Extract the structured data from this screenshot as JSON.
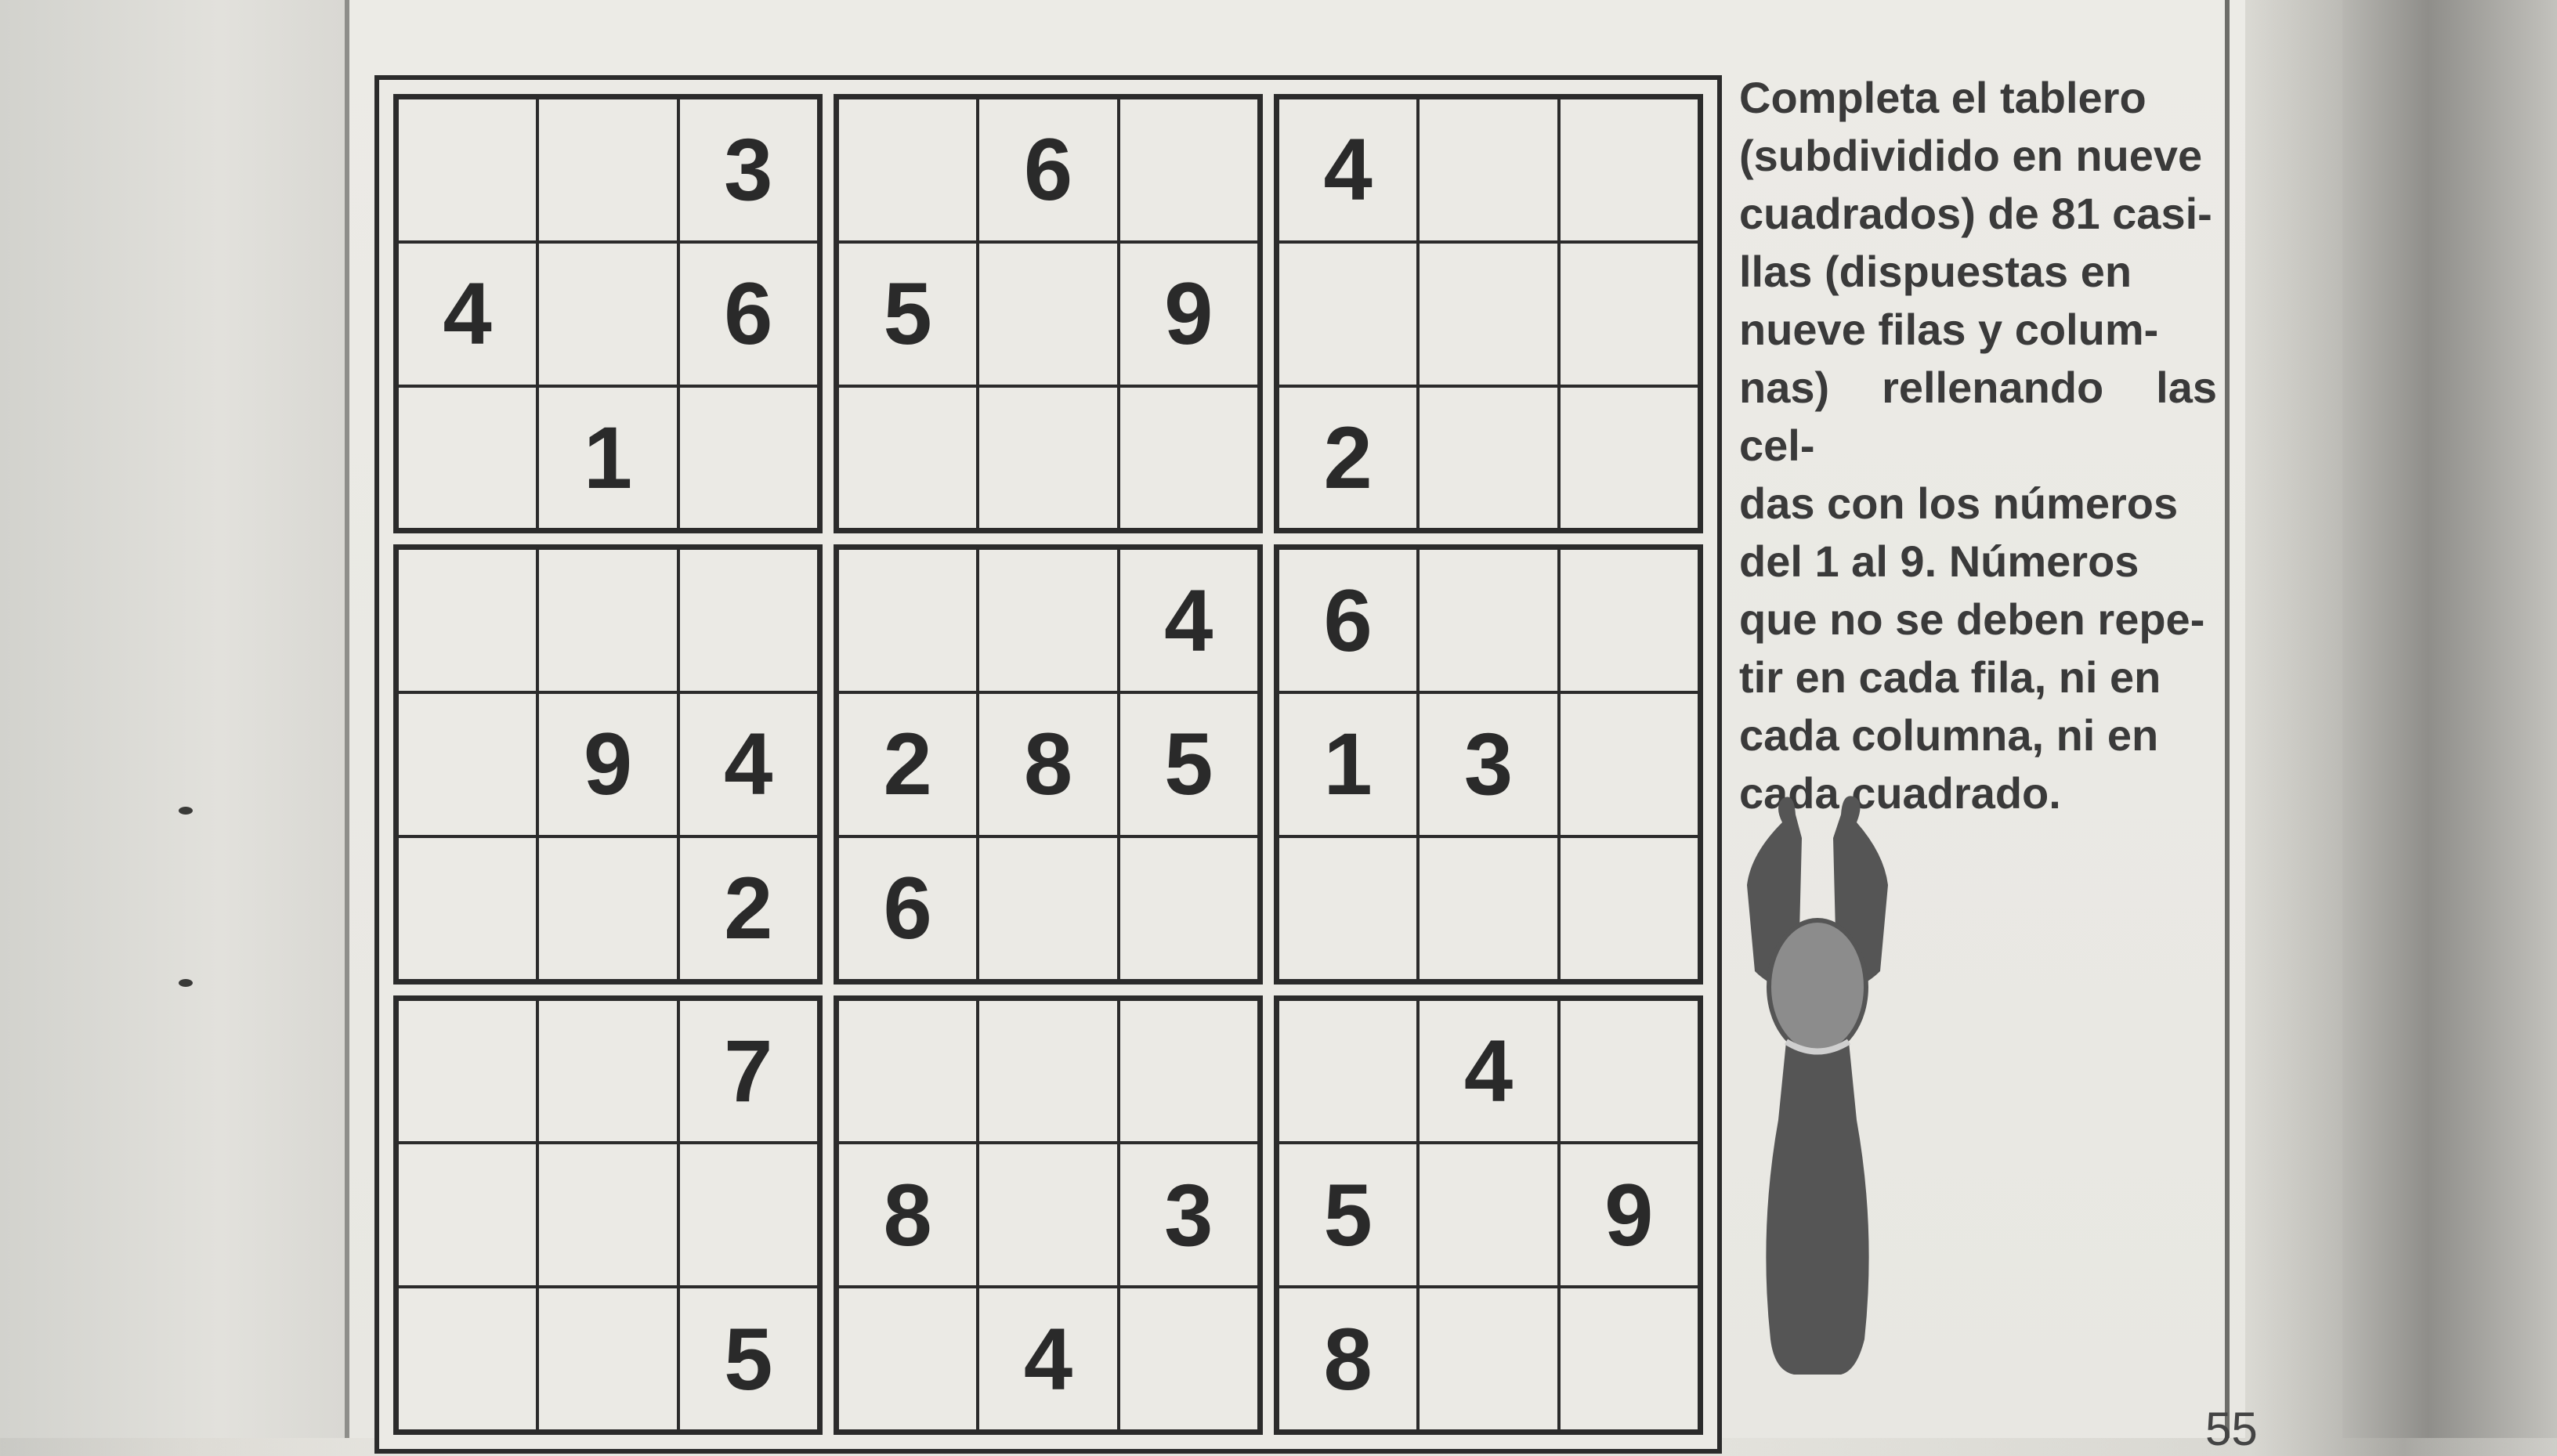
{
  "puzzle": {
    "grid": [
      [
        "",
        "",
        "3",
        "",
        "6",
        "",
        "4",
        "",
        ""
      ],
      [
        "4",
        "",
        "6",
        "5",
        "",
        "9",
        "",
        "",
        ""
      ],
      [
        "",
        "1",
        "",
        "",
        "",
        "",
        "2",
        "",
        ""
      ],
      [
        "",
        "",
        "",
        "",
        "",
        "4",
        "6",
        "",
        ""
      ],
      [
        "",
        "9",
        "4",
        "2",
        "8",
        "5",
        "1",
        "3",
        ""
      ],
      [
        "",
        "",
        "2",
        "6",
        "",
        "",
        "",
        "",
        ""
      ],
      [
        "",
        "",
        "7",
        "",
        "",
        "",
        "",
        "4",
        ""
      ],
      [
        "",
        "",
        "",
        "8",
        "",
        "3",
        "5",
        "",
        "9"
      ],
      [
        "",
        "",
        "5",
        "",
        "4",
        "",
        "8",
        "",
        ""
      ]
    ]
  },
  "instructions": {
    "lines": [
      "Completa el tablero",
      "(subdividido en nueve",
      "cuadrados) de 81 casi-",
      "llas (dispuestas en",
      "nueve filas y colum-",
      "nas) rellenando las cel-",
      "das con los números",
      "del 1 al 9. Números",
      "que no se deben repe-",
      "tir en cada fila, ni en",
      "cada columna, ni en",
      "cada cuadrado."
    ]
  },
  "page_number": "55",
  "colors": {
    "ink": "#2b2b2b",
    "paper": "#ebeae5",
    "figure_fill": "#555555",
    "figure_highlight": "#9a9a9a"
  },
  "icons": {
    "figure": "person-arms-raised-illustration"
  }
}
